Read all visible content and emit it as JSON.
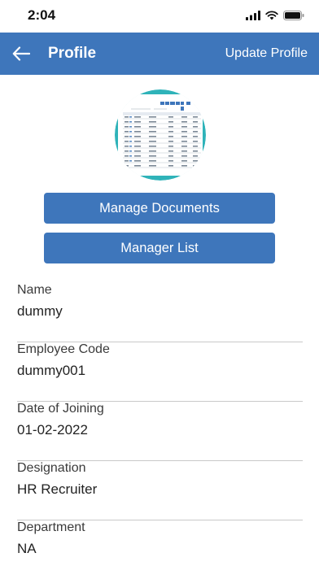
{
  "status": {
    "time": "2:04"
  },
  "header": {
    "title": "Profile",
    "action_label": "Update Profile"
  },
  "buttons": {
    "documents_label": "Manage Documents",
    "managers_label": "Manager List"
  },
  "fields": [
    {
      "label": "Name",
      "value": "dummy"
    },
    {
      "label": "Employee Code",
      "value": "dummy001"
    },
    {
      "label": "Date of Joining",
      "value": "01-02-2022"
    },
    {
      "label": "Designation",
      "value": "HR Recruiter"
    },
    {
      "label": "Department",
      "value": "NA"
    }
  ],
  "colors": {
    "primary": "#3e76bb",
    "avatar_ring": "#2fb3b9"
  },
  "icons": [
    "signal-icon",
    "wifi-icon",
    "battery-icon",
    "back-arrow-icon"
  ]
}
